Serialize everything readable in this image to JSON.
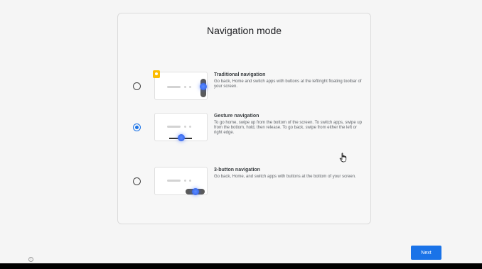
{
  "page": {
    "title": "Navigation mode",
    "next_label": "Next",
    "info_glyph": "i"
  },
  "options": [
    {
      "title": "Traditional navigation",
      "description": "Go back, Home and switch apps with buttons at the left/right floating toolbar of your screen.",
      "selected": false
    },
    {
      "title": "Gesture navigation",
      "description": "To go home, swipe up from the bottom of the screen. To switch apps, swipe up from the bottom, hold, then release. To go back, swipe from either the left or right edge.",
      "selected": true
    },
    {
      "title": "3-button navigation",
      "description": "Go back, Home, and switch apps with buttons at the bottom of your screen.",
      "selected": false
    }
  ],
  "colors": {
    "accent": "#1a73e8",
    "badge": "#fbbc04",
    "background": "#f5f5f5"
  },
  "icons": {
    "info": "info-icon",
    "cursor": "hand-pointer-icon",
    "badge": "floating-toolbar-badge-icon"
  }
}
